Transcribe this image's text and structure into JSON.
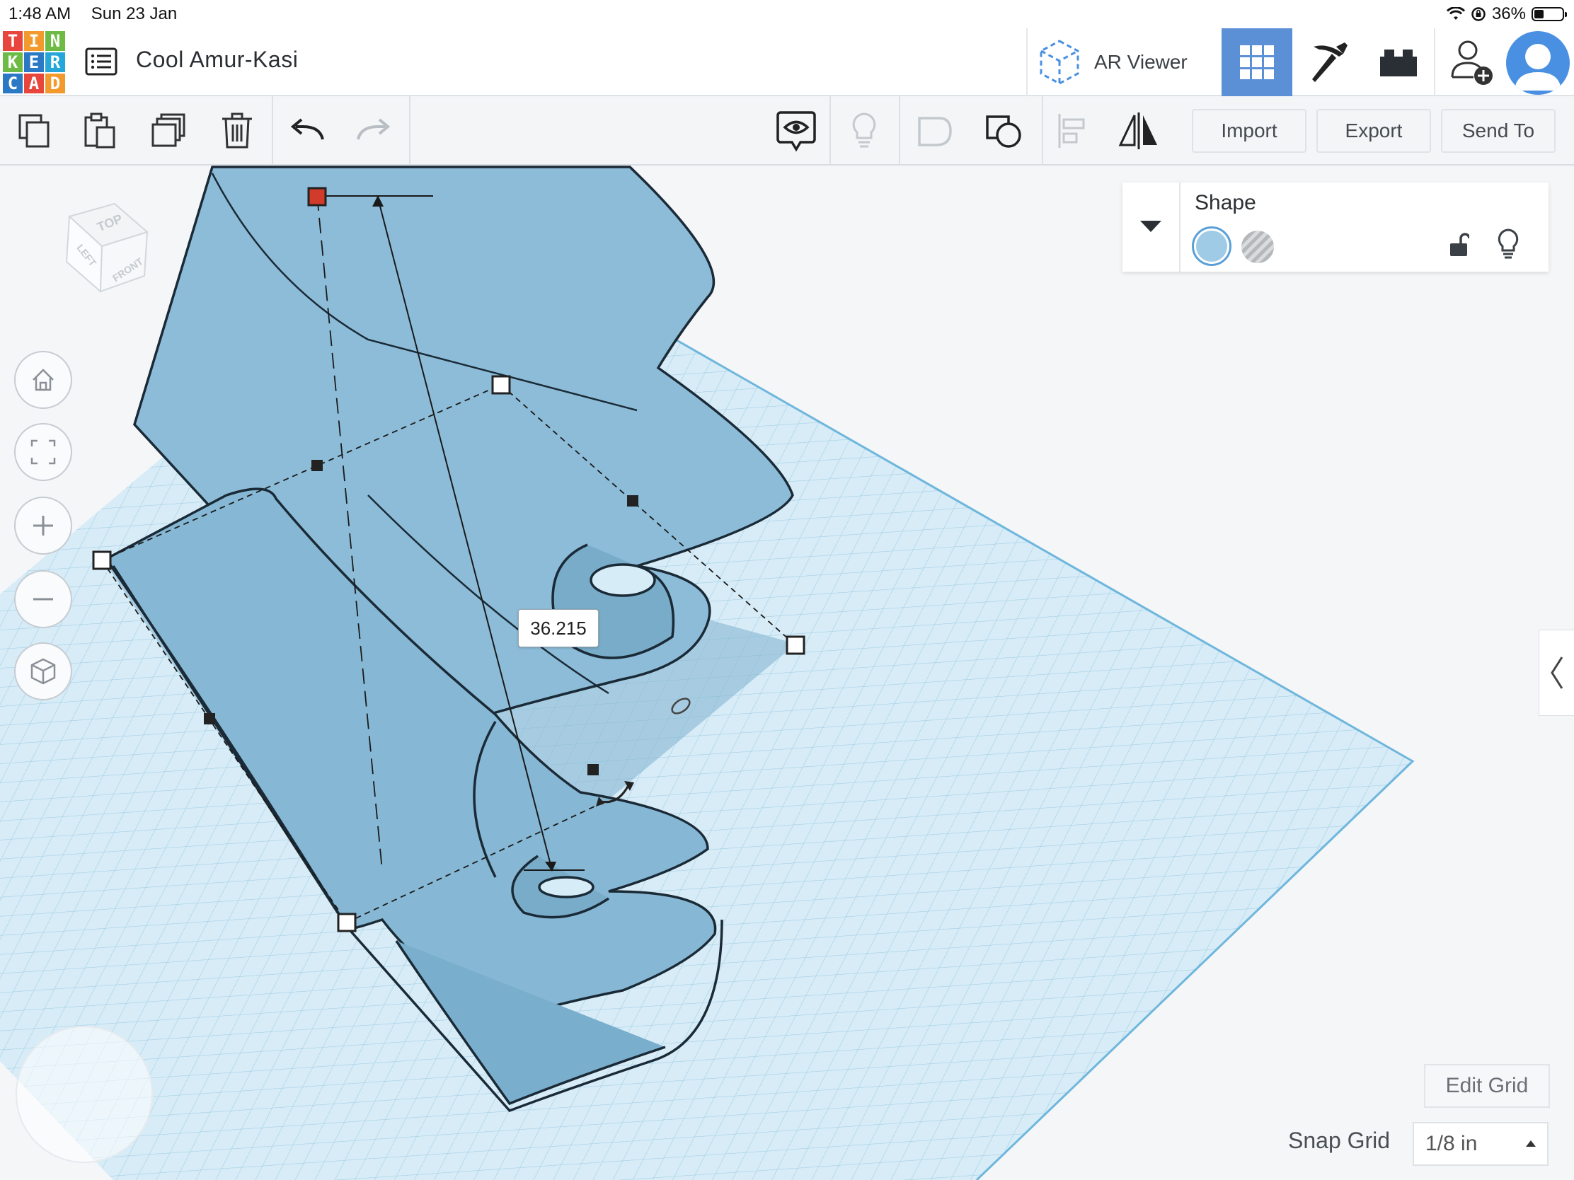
{
  "status_bar": {
    "time": "1:48 AM",
    "date": "Sun 23 Jan",
    "battery": "36%"
  },
  "app": {
    "logo_letters": [
      "T",
      "I",
      "N",
      "K",
      "E",
      "R",
      "C",
      "A",
      "D"
    ],
    "project_title": "Cool Amur-Kasi",
    "ar_viewer_label": "AR Viewer"
  },
  "toolbar": {
    "import_label": "Import",
    "export_label": "Export",
    "send_to_label": "Send To"
  },
  "view_cube": {
    "top": "TOP",
    "left": "LEFT",
    "front": "FRONT"
  },
  "shape_panel": {
    "title": "Shape"
  },
  "measurement": {
    "value": "36.215"
  },
  "grid": {
    "edit_grid_label": "Edit Grid",
    "snap_grid_label": "Snap Grid",
    "snap_grid_value": "1/8 in"
  },
  "colors": {
    "accent": "#5b8fd6",
    "shape_fill": "#9fcbe6",
    "workplane": "#d4eaf5"
  }
}
